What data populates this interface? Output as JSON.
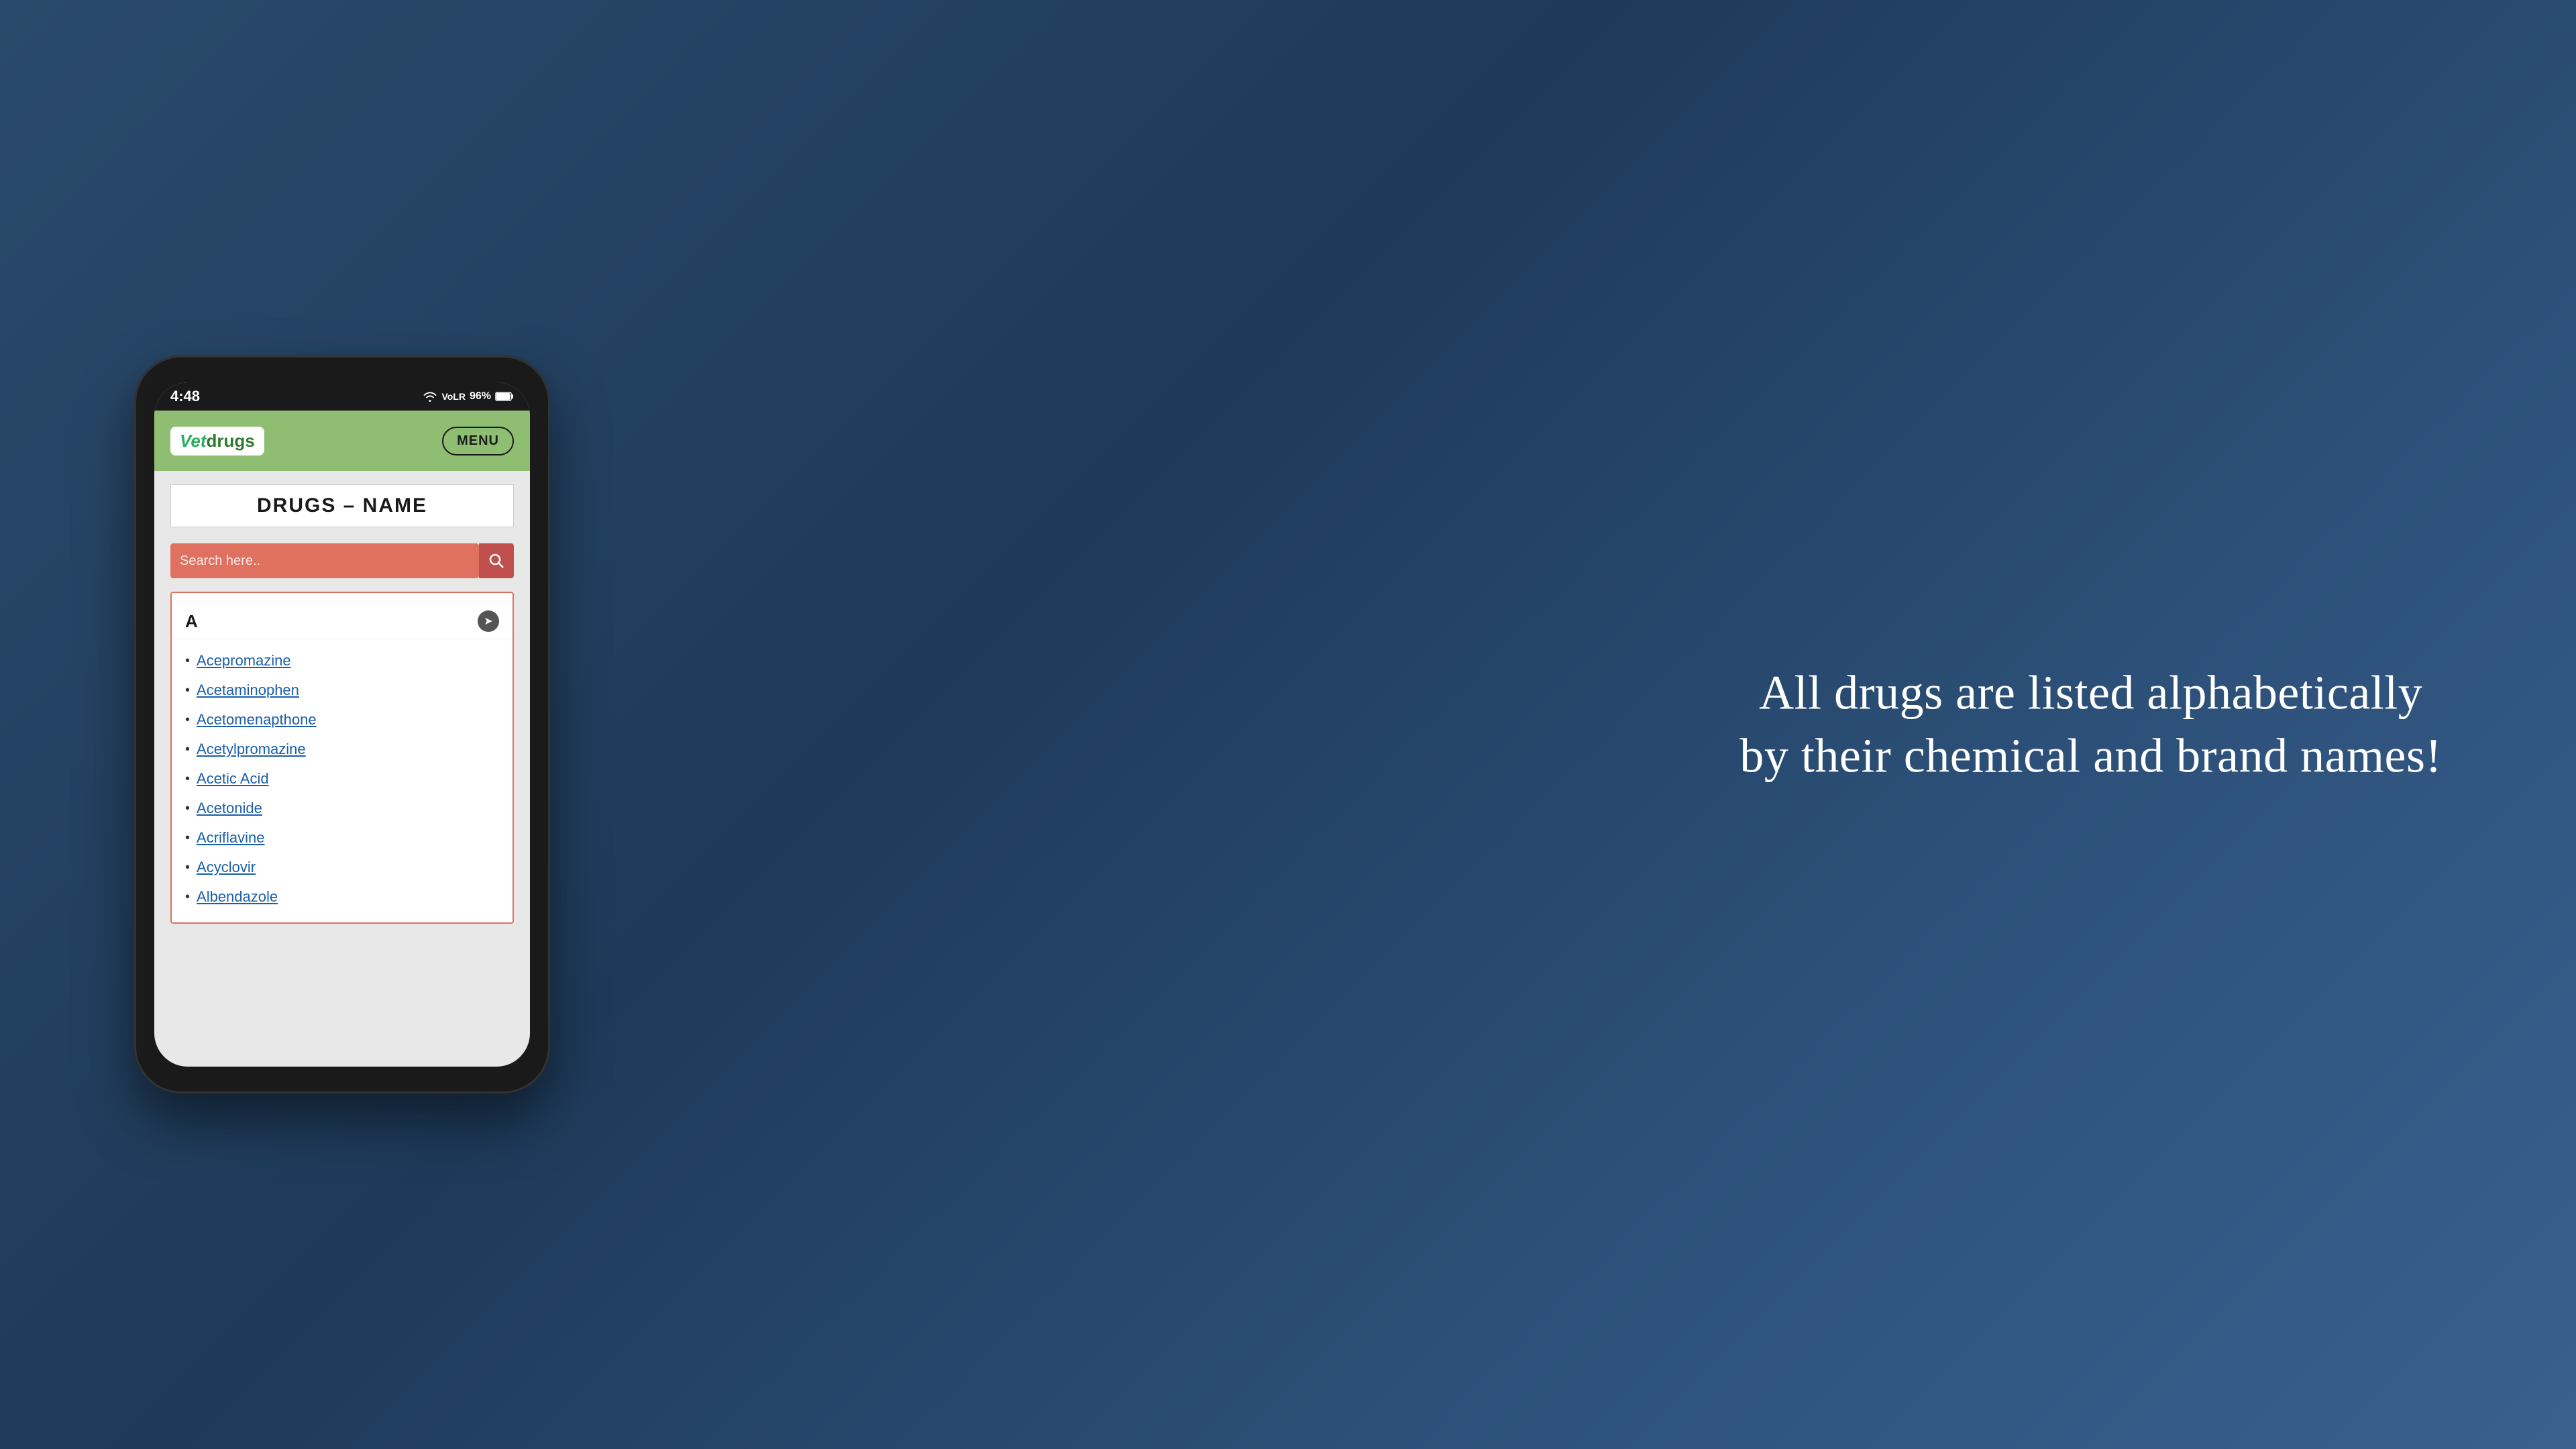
{
  "status_bar": {
    "time": "4:48",
    "icons": "WiFi VoLTE 96%"
  },
  "header": {
    "logo_vet": "Vet",
    "logo_drugs": "drugs",
    "menu_label": "MENU"
  },
  "page": {
    "title": "DRUGS – NAME"
  },
  "search": {
    "placeholder": "Search here.."
  },
  "letter_section": {
    "letter": "A",
    "chevron": "⌄"
  },
  "drug_list": [
    {
      "name": "Acepromazine"
    },
    {
      "name": "Acetaminophen"
    },
    {
      "name": "Acetomenapthone"
    },
    {
      "name": "Acetylpromazine"
    },
    {
      "name": "Acetic Acid"
    },
    {
      "name": "Acetonide"
    },
    {
      "name": "Acriflavine"
    },
    {
      "name": "Acyclovir"
    },
    {
      "name": "Albendazole"
    }
  ],
  "promo_text": {
    "line1": "All drugs are listed alphabetically",
    "line2": "by their chemical and brand names!"
  }
}
